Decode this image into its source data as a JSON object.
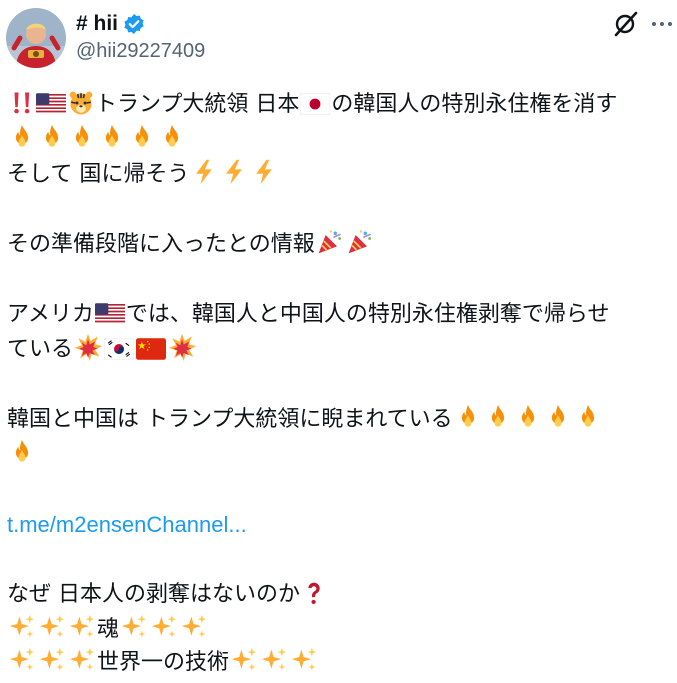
{
  "post": {
    "author": {
      "display_name": "# hii",
      "handle": "@hii29227409",
      "verified": true,
      "avatar_icon": "avatar-person-in-red-costume"
    },
    "header_actions": [
      {
        "name": "grok-icon",
        "label": ""
      },
      {
        "name": "more-options-icon",
        "label": ""
      }
    ],
    "lines": {
      "l1": "トランプ大統領 日本",
      "l1b": "の韓国人の特別永住権を消す",
      "l3": "そして 国に帰そう",
      "l4": "その準備段階に入ったとの情報",
      "l5a": "アメリカ",
      "l5b": "では、韓国人と中国人の特別永住権剥奪で帰らせ",
      "l6": "ている",
      "l7": "韓国と中国は トランプ大統領に睨まれている",
      "link": "t.me/m2ensenChannel...",
      "l8": "なぜ 日本人の剥奪はないのか",
      "l9": "魂",
      "l10": "世界一の技術"
    },
    "colors": {
      "text": "#0f1419",
      "secondary": "#536471",
      "link": "#1d9bf0",
      "verified": "#1d9bf0"
    }
  }
}
